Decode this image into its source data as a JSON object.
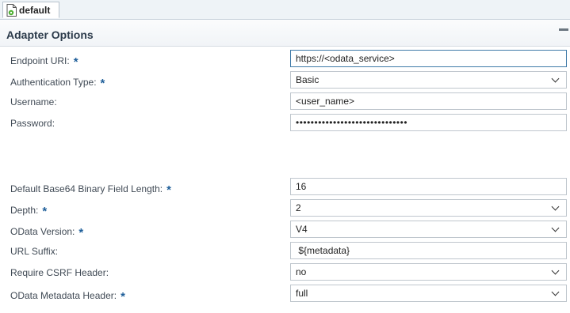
{
  "tab": {
    "label": "default"
  },
  "section": {
    "title": "Adapter Options"
  },
  "required_marker": "*",
  "fields": {
    "endpoint_uri": {
      "label": "Endpoint URI:",
      "value": "https://<odata_service>"
    },
    "auth_type": {
      "label": "Authentication Type:",
      "value": "Basic"
    },
    "username": {
      "label": "Username:",
      "value": "<user_name>"
    },
    "password": {
      "label": "Password:",
      "value": "••••••••••••••••••••••••••••••"
    },
    "base64_length": {
      "label": "Default Base64 Binary Field Length:",
      "value": "16"
    },
    "depth": {
      "label": "Depth:",
      "value": "2"
    },
    "odata_version": {
      "label": "OData Version:",
      "value": "V4"
    },
    "url_suffix": {
      "label": "URL Suffix:",
      "value": " ${metadata}"
    },
    "require_csrf": {
      "label": "Require CSRF Header:",
      "value": "no"
    },
    "metadata_header": {
      "label": "OData Metadata Header:",
      "value": "full"
    }
  },
  "colors": {
    "required": "#1f5f9a",
    "focus_border": "#3f7aa8"
  }
}
